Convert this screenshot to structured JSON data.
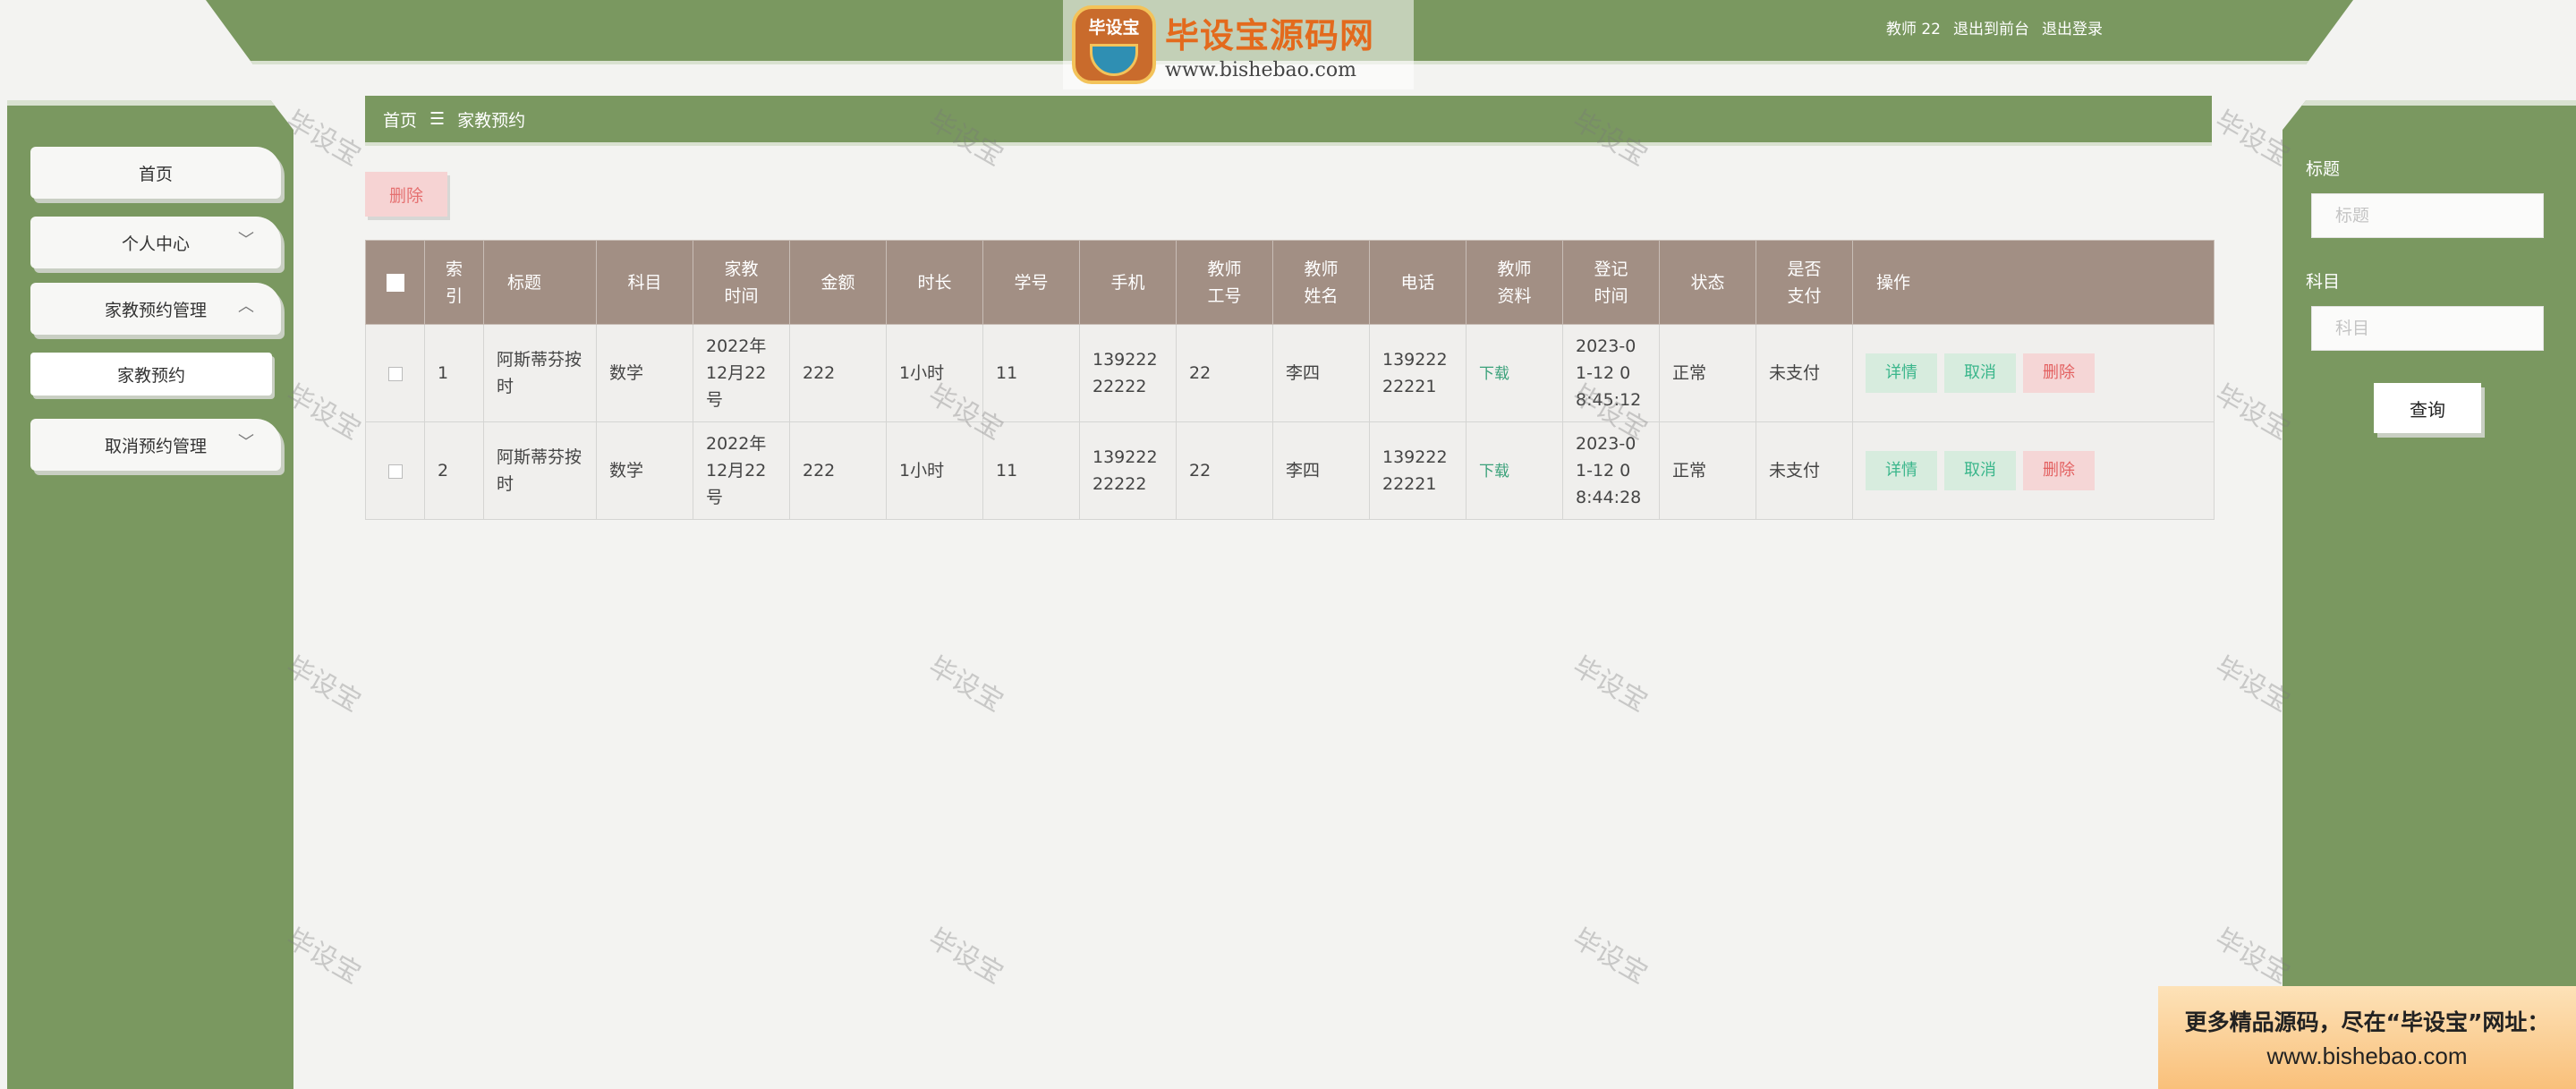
{
  "header": {
    "user_label": "教师 22",
    "to_front_label": "退出到前台",
    "logout_label": "退出登录"
  },
  "logo": {
    "badge_text": "毕设宝",
    "title": "毕设宝源码网",
    "url": "www.bishebao.com"
  },
  "sidebar": {
    "items": [
      {
        "label": "首页"
      },
      {
        "label": "个人中心"
      },
      {
        "label": "家教预约管理"
      },
      {
        "label": "家教预约"
      },
      {
        "label": "取消预约管理"
      }
    ]
  },
  "breadcrumb": {
    "home": "首页",
    "separator": "☰",
    "current": "家教预约"
  },
  "toolbar": {
    "delete_label": "删除"
  },
  "table": {
    "headers": [
      "索引",
      "标题",
      "科目",
      "家教时间",
      "金额",
      "时长",
      "学号",
      "手机",
      "教师工号",
      "教师姓名",
      "电话",
      "教师资料",
      "登记时间",
      "状态",
      "是否支付",
      "操作"
    ],
    "header_lines": {
      "index": [
        "索",
        "引"
      ],
      "time": [
        "家教",
        "时间"
      ],
      "teacher_no": [
        "教师",
        "工号"
      ],
      "teacher_name": [
        "教师",
        "姓名"
      ],
      "teacher_file": [
        "教师",
        "资料"
      ],
      "reg_time": [
        "登记",
        "时间"
      ],
      "paid": [
        "是否",
        "支付"
      ]
    },
    "rows": [
      {
        "index": "1",
        "title": "阿斯蒂芬按时",
        "subject": "数学",
        "time": "2022年12月22号",
        "amount": "222",
        "duration": "1小时",
        "student_no": "11",
        "mobile": "13922222222",
        "teacher_no": "22",
        "teacher_name": "李四",
        "phone": "13922222221",
        "file": "下载",
        "reg_time": "2023-01-12 08:45:12",
        "status": "正常",
        "paid": "未支付"
      },
      {
        "index": "2",
        "title": "阿斯蒂芬按时",
        "subject": "数学",
        "time": "2022年12月22号",
        "amount": "222",
        "duration": "1小时",
        "student_no": "11",
        "mobile": "13922222222",
        "teacher_no": "22",
        "teacher_name": "李四",
        "phone": "13922222221",
        "file": "下载",
        "reg_time": "2023-01-12 08:44:28",
        "status": "正常",
        "paid": "未支付"
      }
    ],
    "actions": {
      "detail": "详情",
      "cancel": "取消",
      "delete": "删除"
    }
  },
  "search": {
    "title_label": "标题",
    "title_placeholder": "标题",
    "subject_label": "科目",
    "subject_placeholder": "科目",
    "button_label": "查询"
  },
  "watermark": "毕设宝",
  "promo": {
    "line1": "更多精品源码，尽在“毕设宝”网址：",
    "line2": "www.bishebao.com"
  },
  "colors": {
    "theme_green": "#7a9860",
    "table_header": "#a28f84",
    "action_green": "#3ab68b",
    "action_red": "#e36161"
  }
}
